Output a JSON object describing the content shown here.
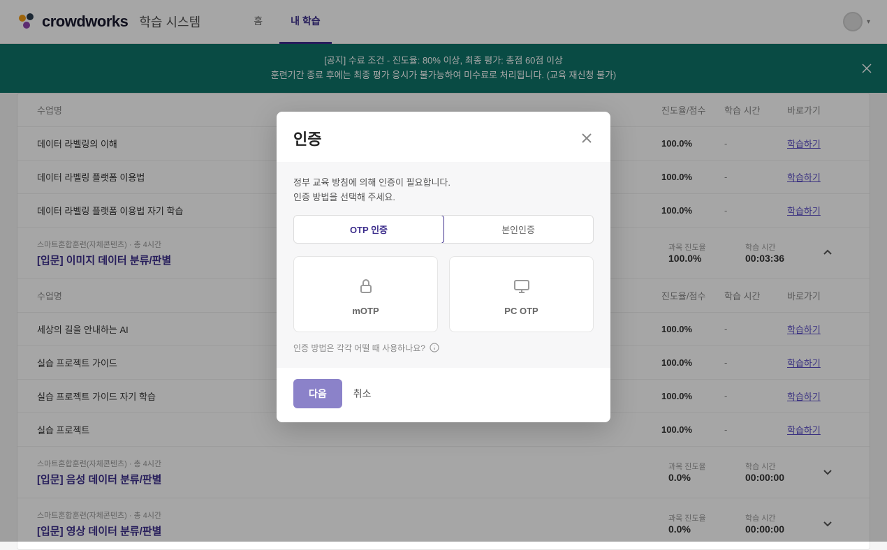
{
  "header": {
    "logo_text": "crowdworks",
    "logo_sub": "학습 시스템",
    "nav": {
      "home": "홈",
      "my": "내 학습"
    }
  },
  "banner": {
    "line1": "[공지] 수료 조건 - 진도율: 80% 이상, 최종 평가: 총점 60점 이상",
    "line2": "훈련기간 종료 후에는 최종 평가 응시가 불가능하여 미수료로 처리됩니다. (교육 재신청 불가)"
  },
  "cols": {
    "name": "수업명",
    "score": "진도율/점수",
    "time": "학습 시간",
    "go": "바로가기"
  },
  "link_label": "학습하기",
  "dash": "-",
  "sections": [
    {
      "rows": [
        {
          "name": "데이터 라벨링의 이해",
          "score": "100.0%"
        },
        {
          "name": "데이터 라벨링 플랫폼 이용법",
          "score": "100.0%"
        },
        {
          "name": "데이터 라벨링 플랫폼 이용법 자기 학습",
          "score": "100.0%"
        }
      ]
    }
  ],
  "section1": {
    "meta": "스마트혼합훈련(자체콘텐츠) · 총 4시간",
    "title": "[입문] 이미지 데이터 분류/판별",
    "progress_label": "과목 진도율",
    "progress": "100.0%",
    "time_label": "학습 시간",
    "time": "00:03:36",
    "rows": [
      {
        "name": "세상의 길을 안내하는 AI",
        "score": "100.0%"
      },
      {
        "name": "실습 프로젝트 가이드",
        "score": "100.0%"
      },
      {
        "name": "실습 프로젝트 가이드 자기 학습",
        "score": "100.0%"
      },
      {
        "name": "실습 프로젝트",
        "score": "100.0%"
      }
    ]
  },
  "section2": {
    "meta": "스마트혼합훈련(자체콘텐츠) · 총 4시간",
    "title": "[입문] 음성 데이터 분류/판별",
    "progress_label": "과목 진도율",
    "progress": "0.0%",
    "time_label": "학습 시간",
    "time": "00:00:00"
  },
  "section3": {
    "meta": "스마트혼합훈련(자체콘텐츠) · 총 4시간",
    "title": "[입문] 영상 데이터 분류/판별",
    "progress_label": "과목 진도율",
    "progress": "0.0%",
    "time_label": "학습 시간",
    "time": "00:00:00"
  },
  "modal": {
    "title": "인증",
    "desc1": "정부 교육 방침에 의해 인증이 필요합니다.",
    "desc2": "인증 방법을 선택해 주세요.",
    "tab_otp": "OTP 인증",
    "tab_self": "본인인증",
    "opt_motp": "mOTP",
    "opt_pcotp": "PC OTP",
    "help": "인증 방법은 각각 어떨 때 사용하나요?",
    "next": "다음",
    "cancel": "취소"
  }
}
